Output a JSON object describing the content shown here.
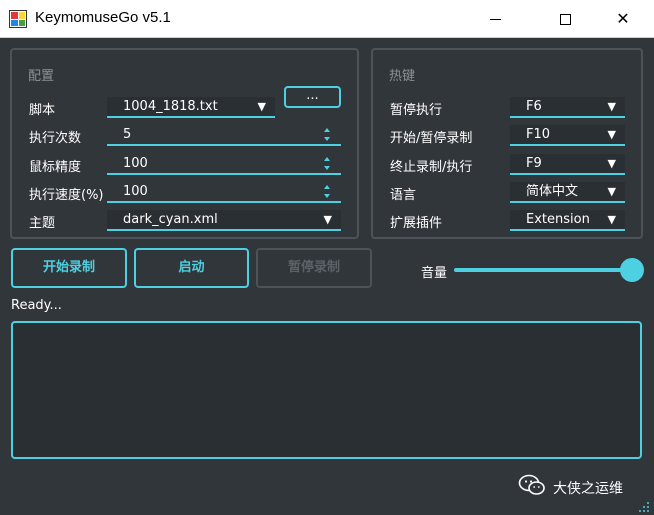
{
  "window": {
    "title": "KeymomuseGo v5.1",
    "close_glyph": "✕"
  },
  "config": {
    "group_title": "配置",
    "script_label": "脚本",
    "script_value": "1004_1818.txt",
    "browse_label": "...",
    "exec_count_label": "执行次数",
    "exec_count_value": "5",
    "mouse_precision_label": "鼠标精度",
    "mouse_precision_value": "100",
    "exec_speed_label": "执行速度(%)",
    "exec_speed_value": "100",
    "theme_label": "主题",
    "theme_value": "dark_cyan.xml"
  },
  "hotkeys": {
    "group_title": "热键",
    "pause_label": "暂停执行",
    "pause_value": "F6",
    "record_label": "开始/暂停录制",
    "record_value": "F10",
    "stop_label": "终止录制/执行",
    "stop_value": "F9",
    "language_label": "语言",
    "language_value": "简体中文",
    "plugin_label": "扩展插件",
    "plugin_value": "Extension"
  },
  "actions": {
    "start_record": "开始录制",
    "launch": "启动",
    "pause_record": "暂停录制"
  },
  "volume": {
    "label": "音量",
    "level": 1.0
  },
  "status": {
    "text": "Ready..."
  },
  "watermark": {
    "text": "大侠之运维"
  },
  "icons": {
    "dropdown": "▼",
    "watermark_icon": "wechat-icon"
  },
  "colors": {
    "accent": "#4dd0e1",
    "background": "#31363b",
    "group_border": "#4d5359"
  }
}
